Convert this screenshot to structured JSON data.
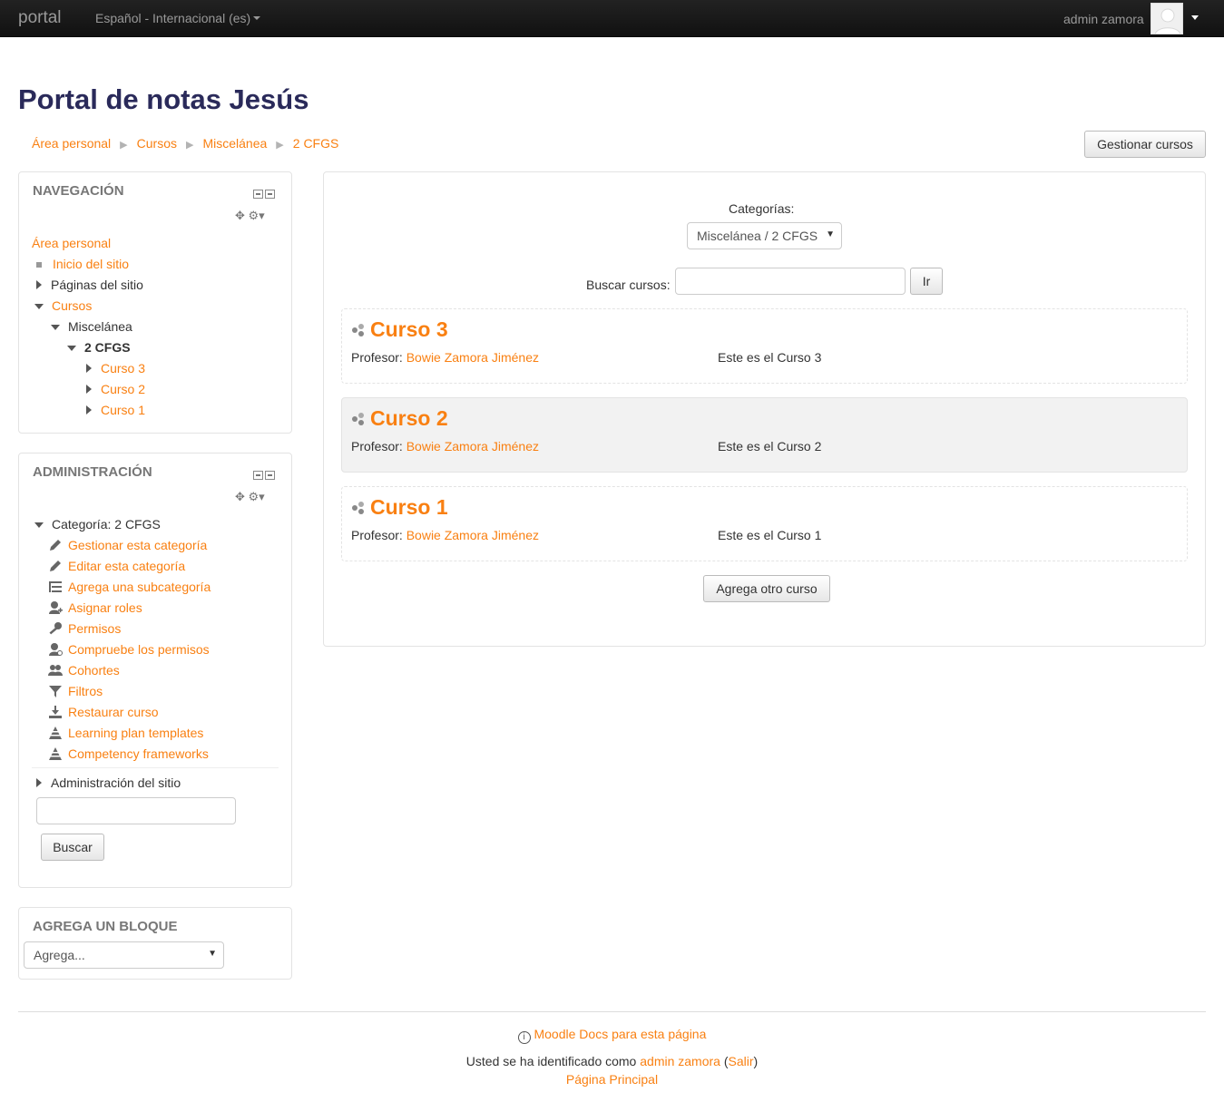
{
  "navbar": {
    "brand": "portal",
    "language": "Español - Internacional (es)",
    "user": "admin zamora"
  },
  "page": {
    "title": "Portal de notas Jesús",
    "manage_button": "Gestionar cursos"
  },
  "breadcrumb": [
    "Área personal",
    "Cursos",
    "Miscelánea",
    "2 CFGS"
  ],
  "navigation": {
    "title": "NAVEGACIÓN",
    "items": {
      "home": "Área personal",
      "site_home": "Inicio del sitio",
      "site_pages": "Páginas del sitio",
      "courses": "Cursos",
      "misc": "Miscelánea",
      "cfgs": "2 CFGS",
      "curso3": "Curso 3",
      "curso2": "Curso 2",
      "curso1": "Curso 1"
    }
  },
  "administration": {
    "title": "ADMINISTRACIÓN",
    "category": "Categoría: 2 CFGS",
    "items": [
      {
        "label": "Gestionar esta categoría",
        "icon": "pencil-icon"
      },
      {
        "label": "Editar esta categoría",
        "icon": "pencil-icon"
      },
      {
        "label": "Agrega una subcategoría",
        "icon": "subcategory-icon"
      },
      {
        "label": "Asignar roles",
        "icon": "assign-roles-icon"
      },
      {
        "label": "Permisos",
        "icon": "key-icon"
      },
      {
        "label": "Compruebe los permisos",
        "icon": "check-permissions-icon"
      },
      {
        "label": "Cohortes",
        "icon": "cohorts-icon"
      },
      {
        "label": "Filtros",
        "icon": "filter-icon"
      },
      {
        "label": "Restaurar curso",
        "icon": "restore-icon"
      },
      {
        "label": "Learning plan templates",
        "icon": "competency-icon"
      },
      {
        "label": "Competency frameworks",
        "icon": "competency-icon"
      }
    ],
    "site_admin": "Administración del sitio",
    "search_button": "Buscar"
  },
  "add_block": {
    "title": "AGREGA UN BLOQUE",
    "select": "Agrega..."
  },
  "main": {
    "categories_label": "Categorías:",
    "category_selected": "Miscelánea / 2 CFGS",
    "search_label": "Buscar cursos:",
    "search_button": "Ir",
    "teacher_label": "Profesor:",
    "courses": [
      {
        "name": "Curso 3",
        "teacher": "Bowie Zamora Jiménez",
        "summary": "Este es el Curso 3"
      },
      {
        "name": "Curso 2",
        "teacher": "Bowie Zamora Jiménez",
        "summary": "Este es el Curso 2"
      },
      {
        "name": "Curso 1",
        "teacher": "Bowie Zamora Jiménez",
        "summary": "Este es el Curso 1"
      }
    ],
    "add_course_button": "Agrega otro curso"
  },
  "footer": {
    "docs_link": "Moodle Docs para esta página",
    "logged_in_prefix": "Usted se ha identificado como",
    "user": "admin zamora",
    "logout": "Salir",
    "home": "Página Principal"
  },
  "colors": {
    "accent": "#f98012",
    "title": "#2a2a5a",
    "navbar": "#1a1a1a"
  }
}
